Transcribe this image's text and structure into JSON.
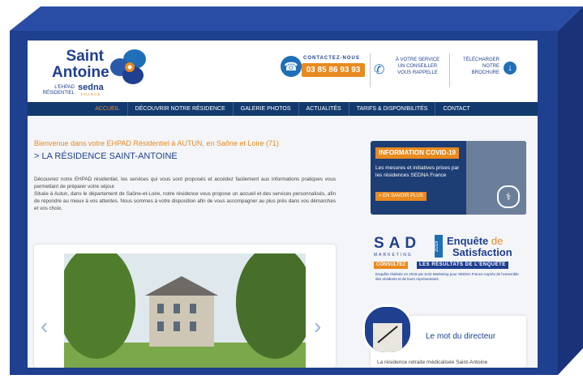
{
  "colors": {
    "frame": "#1f3f8f",
    "accent": "#e88a1f",
    "nav": "#133a6e",
    "brand": "#1f3f8f"
  },
  "logo": {
    "line1": "Saint",
    "line2": "Antoine",
    "sub1": "L'EHPAD",
    "sub2": "RÉSIDENTIEL",
    "brand": "sedna",
    "brand_sub": "FRANCE"
  },
  "contact": {
    "label": "CONTACTEZ-NOUS",
    "phone": "03 85 86 93 93",
    "icon": "phone-icon"
  },
  "callback": {
    "line1": "À VOTRE SERVICE",
    "line2": "UN CONSEILLER",
    "line3": "VOUS RAPPELLE",
    "icon": "phone-callback-icon"
  },
  "brochure": {
    "line1": "TÉLÉCHARGER",
    "line2": "NOTRE",
    "line3": "BROCHURE",
    "icon": "download-icon"
  },
  "nav": [
    {
      "label": "ACCUEIL",
      "active": true
    },
    {
      "label": "DÉCOUVRIR NOTRE RÉSIDENCE",
      "active": false
    },
    {
      "label": "GALERIE PHOTOS",
      "active": false
    },
    {
      "label": "ACTUALITÉS",
      "active": false
    },
    {
      "label": "TARIFS & DISPONIBILITÉS",
      "active": false
    },
    {
      "label": "CONTACT",
      "active": false
    }
  ],
  "main": {
    "welcome": "Bienvenue dans votre EHPAD Résidentiel à AUTUN, en Saône et Loire (71)",
    "title": "> LA RÉSIDENCE SAINT-ANTOINE",
    "para1": "Découvrez notre EHPAD résidentiel, les services qui vous sont proposés et accédez facilement aux informations pratiques vous permettant de préparer votre séjour.",
    "para2": "Située à Autun, dans le département de Saône-et-Loire, notre résidence vous propose un accueil et des services personnalisés, afin de répondre au mieux à vos attentes. Nous sommes à votre disposition afin de vous accompagner au plus près dans vos démarches et vos choix."
  },
  "slider": {
    "prev": "‹",
    "next": "›"
  },
  "covid": {
    "title": "INFORMATION COVID-19",
    "text": "Les mesures et initiatives prises par les résidences SEDNA France",
    "more": "> EN SAVOIR PLUS",
    "icon": "stethoscope-icon"
  },
  "sad": {
    "logo": "SAD",
    "marketing": "MARKETING",
    "year": "2019",
    "title_a": "Enquête",
    "title_b": "de",
    "title_c": "Satisfaction",
    "consult": "CONSULTEZ",
    "results": "LES RÉSULTATS DE L'ENQUÊTE",
    "note": "Enquête réalisée en 2019 par SAD Marketing pour SEDNA France Auprès de l'ensemble des résidents et de leurs représentants"
  },
  "director": {
    "title": "Le mot du directeur",
    "text": "La résidence retraite médicalisée Saint-Antoine"
  }
}
